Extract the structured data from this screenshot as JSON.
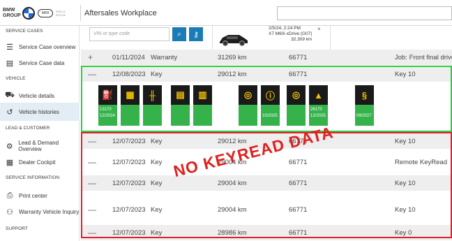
{
  "header": {
    "brand_bmw": "BMW GROUP",
    "brand_mini": "MINI",
    "brand_rr": "ROLLS-ROYCE",
    "app_title": "Aftersales Workplace",
    "search_value": ""
  },
  "sidebar": {
    "sections": {
      "service_cases": "SERVICE CASES",
      "vehicle": "VEHICLE",
      "lead_customer": "LEAD & CUSTOMER",
      "service_information": "SERVICE INFORMATION",
      "support": "SUPPORT"
    },
    "items": [
      {
        "label": "Service Case overview",
        "icon": "list-icon"
      },
      {
        "label": "Service Case data",
        "icon": "clipboard-icon"
      },
      {
        "label": "Vehicle details",
        "icon": "car-icon"
      },
      {
        "label": "Vehicle histories",
        "icon": "history-icon",
        "active": true
      },
      {
        "label": "Lead & Demand Overview",
        "icon": "lead-icon"
      },
      {
        "label": "Dealer Cockpit",
        "icon": "cockpit-icon"
      },
      {
        "label": "Print center",
        "icon": "printer-icon"
      },
      {
        "label": "Warranty Vehicle Inquiry",
        "icon": "warranty-icon"
      }
    ]
  },
  "filter": {
    "vin_placeholder": "VIN or type code",
    "search_icon": "search-icon",
    "key_icon": "key-icon"
  },
  "vehicle_tab": {
    "datetime": "2/5/24, 2:24 PM",
    "model": "X7 M60i xDrive (G07)",
    "mileage": "32,309 km",
    "close": "×"
  },
  "rows": [
    {
      "toggle": "+",
      "date": "01/11/2024",
      "type": "Warranty",
      "km": "31269 km",
      "code": "66771",
      "info": "Job: Front final drive"
    },
    {
      "toggle": "—",
      "date": "12/08/2023",
      "type": "Key",
      "km": "29012 km",
      "code": "66771",
      "info": "Key 10"
    },
    {
      "toggle": "—",
      "date": "12/07/2023",
      "type": "Key",
      "km": "29012 km",
      "code": "66771",
      "info": "Key 10"
    },
    {
      "toggle": "—",
      "date": "12/07/2023",
      "type": "Key",
      "km": "29004 km",
      "code": "66771",
      "info": "Remote KeyRead"
    },
    {
      "toggle": "—",
      "date": "12/07/2023",
      "type": "Key",
      "km": "29004 km",
      "code": "66771",
      "info": "Key 10"
    },
    {
      "toggle": "—",
      "date": "12/07/2023",
      "type": "Key",
      "km": "29004 km",
      "code": "66771",
      "info": "Key 10"
    },
    {
      "toggle": "—",
      "date": "12/07/2023",
      "type": "Key",
      "km": "28986 km",
      "code": "66771",
      "info": "Key 0"
    }
  ],
  "service_icons": [
    {
      "name": "oil-icon",
      "glyph": "⛽",
      "line1": "13170",
      "line2": "12/2024"
    },
    {
      "name": "microfilter-icon",
      "glyph": "▦",
      "line1": "",
      "line2": ""
    },
    {
      "name": "spark-plug-icon",
      "glyph": "╫",
      "line1": "",
      "line2": ""
    },
    {
      "name": "fuel-filter-icon",
      "glyph": "▤",
      "line1": "",
      "line2": ""
    },
    {
      "name": "air-filter-icon",
      "glyph": "▥",
      "line1": "",
      "line2": ""
    },
    {
      "name": "front-brake-icon",
      "glyph": "◎",
      "line1": "",
      "line2": ""
    },
    {
      "name": "brake-fluid-icon",
      "glyph": "ⓘ",
      "line1": "",
      "line2": "10/2025"
    },
    {
      "name": "rear-brake-icon",
      "glyph": "◎",
      "line1": "",
      "line2": ""
    },
    {
      "name": "vehicle-check-icon",
      "glyph": "▲",
      "line1": "26170",
      "line2": "12/2025"
    },
    {
      "name": "inspection-icon",
      "glyph": "§",
      "line1": "",
      "line2": "09/2027"
    }
  ],
  "overlay_text": "NO KEYREAD DATA",
  "colors": {
    "green": "#2ecc40",
    "red": "#e0202a",
    "accent": "#1a7bb5",
    "tile_green": "#35b34a"
  }
}
